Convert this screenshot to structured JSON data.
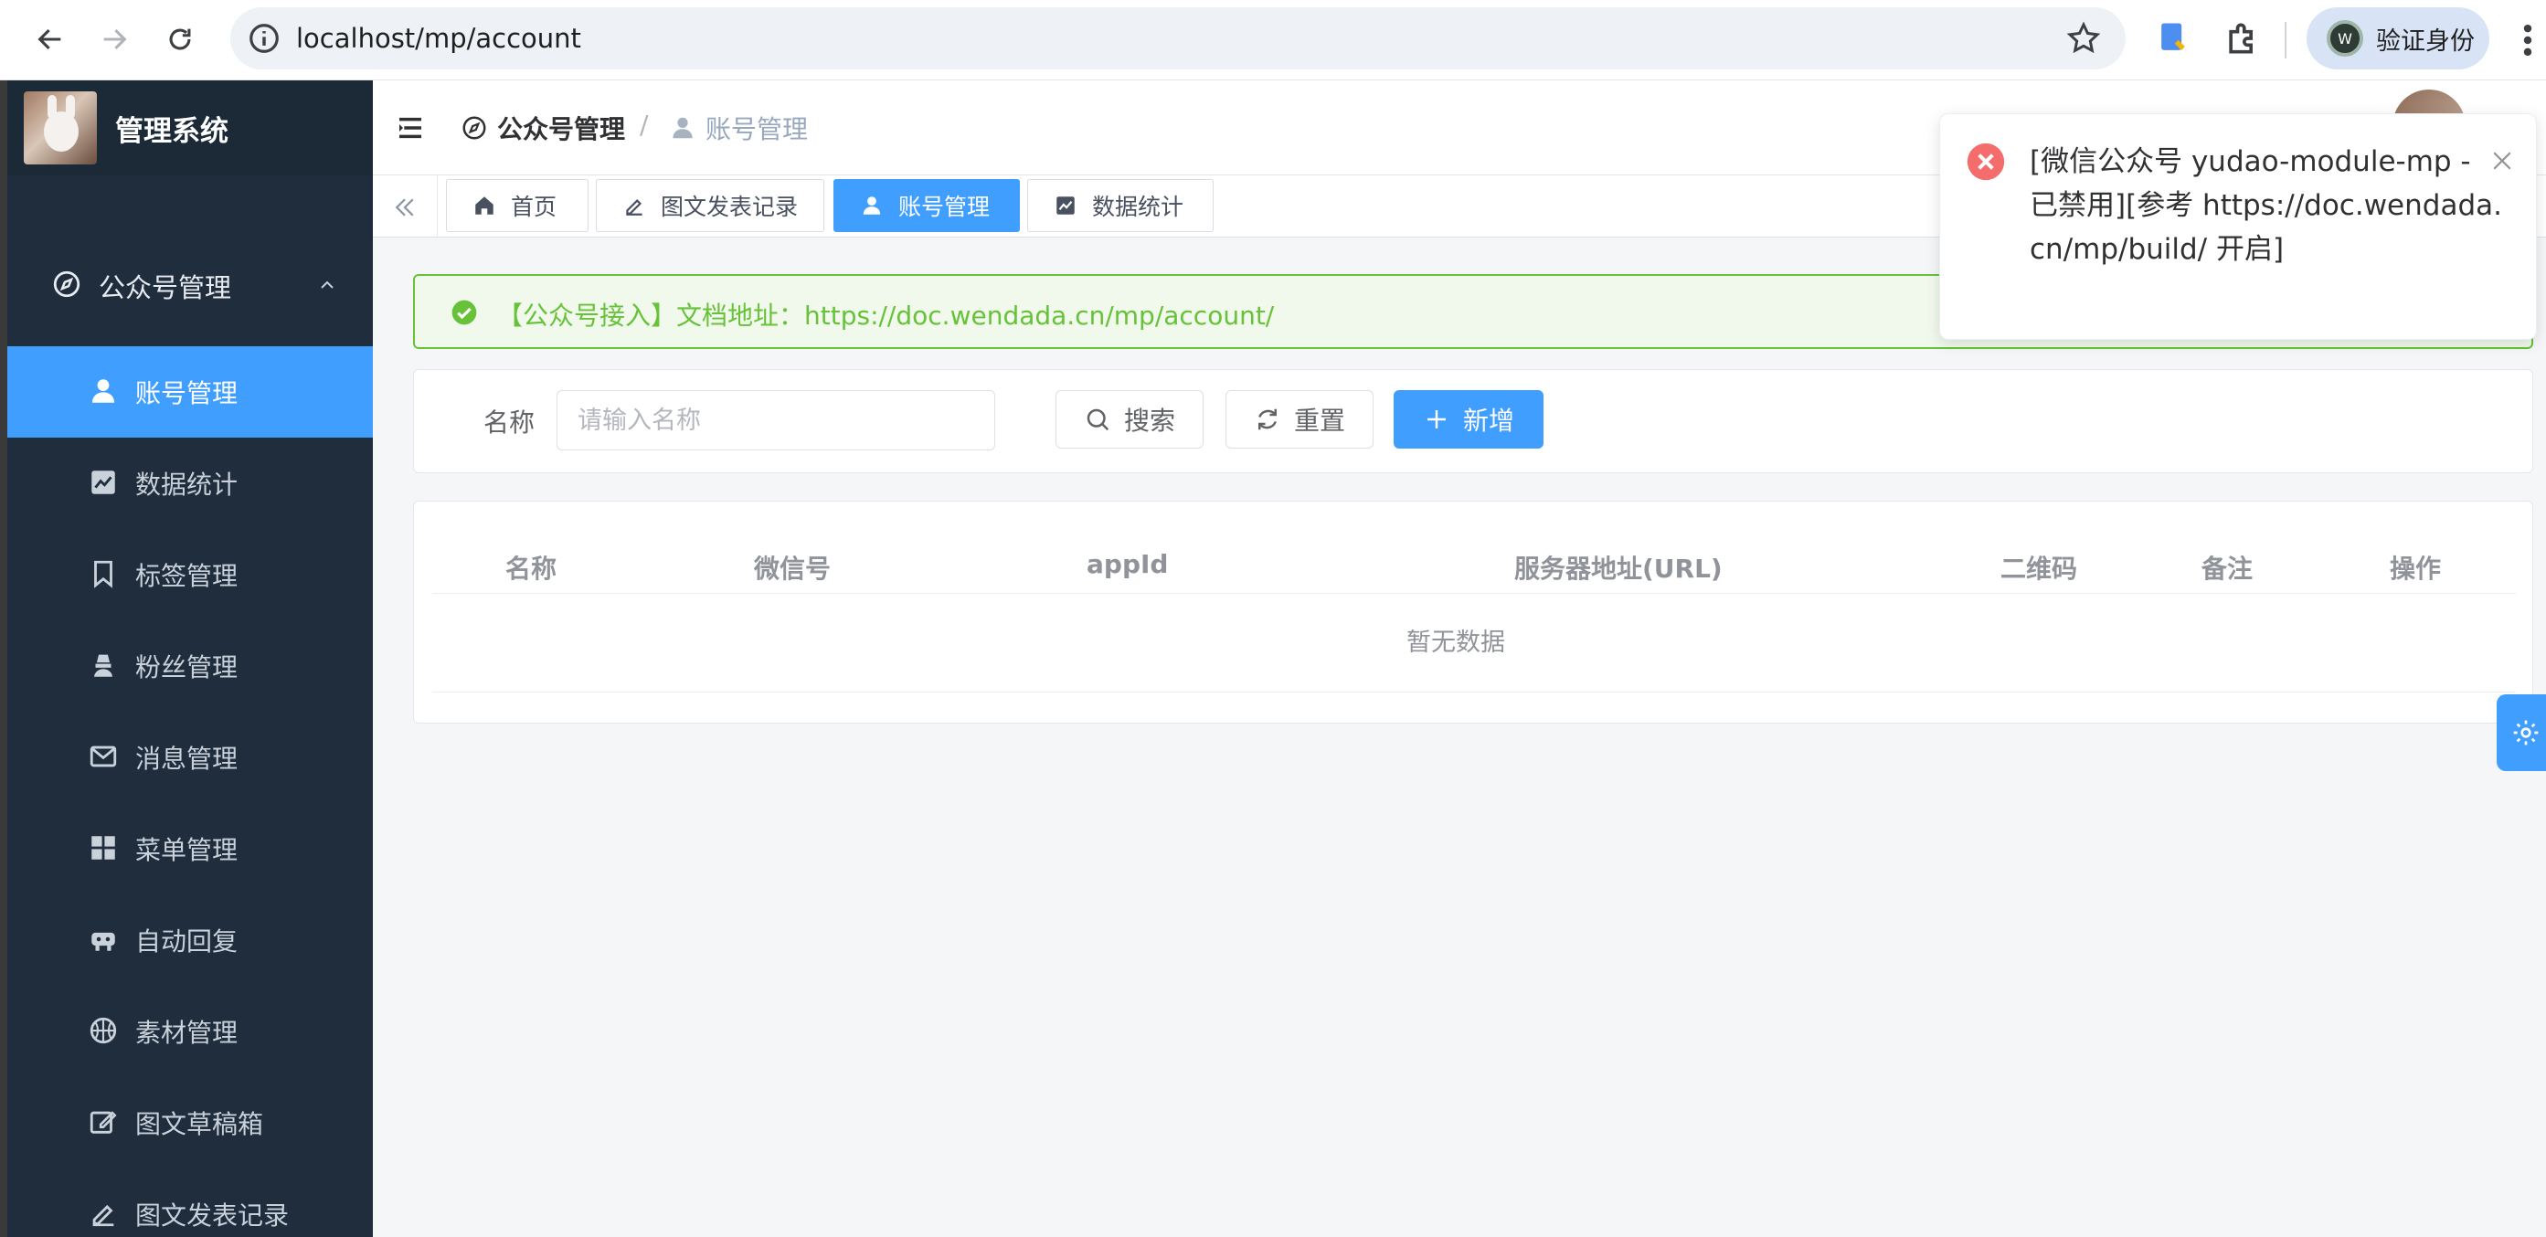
{
  "browser": {
    "url": "localhost/mp/account",
    "profile_label": "验证身份",
    "profile_initial": "W"
  },
  "sidebar": {
    "title": "管理系统",
    "parent_label": "公众号管理",
    "items": [
      {
        "label": "账号管理",
        "icon": "user-icon",
        "active": true
      },
      {
        "label": "数据统计",
        "icon": "chart-icon"
      },
      {
        "label": "标签管理",
        "icon": "bookmark-icon"
      },
      {
        "label": "粉丝管理",
        "icon": "fans-icon"
      },
      {
        "label": "消息管理",
        "icon": "mail-icon"
      },
      {
        "label": "菜单管理",
        "icon": "grid-icon"
      },
      {
        "label": "自动回复",
        "icon": "robot-icon"
      },
      {
        "label": "素材管理",
        "icon": "basketball-icon"
      },
      {
        "label": "图文草稿箱",
        "icon": "edit-box-icon"
      },
      {
        "label": "图文发表记录",
        "icon": "pen-icon"
      }
    ]
  },
  "header": {
    "breadcrumb_root": "公众号管理",
    "breadcrumb_sep": "/",
    "breadcrumb_current": "账号管理"
  },
  "tags": [
    {
      "label": "首页",
      "icon": "home-icon"
    },
    {
      "label": "图文发表记录",
      "icon": "pen-icon"
    },
    {
      "label": "账号管理",
      "icon": "user-icon",
      "active": true
    },
    {
      "label": "数据统计",
      "icon": "chart-icon"
    }
  ],
  "alert": {
    "text": "【公众号接入】文档地址：https://doc.wendada.cn/mp/account/"
  },
  "search": {
    "name_label": "名称",
    "name_placeholder": "请输入名称",
    "name_value": "",
    "search_label": "搜索",
    "reset_label": "重置",
    "add_label": "新增"
  },
  "table": {
    "columns": [
      "名称",
      "微信号",
      "appId",
      "服务器地址(URL)",
      "二维码",
      "备注",
      "操作"
    ],
    "rows": [],
    "empty_text": "暂无数据"
  },
  "notification": {
    "type": "error",
    "text": "[微信公众号 yudao-module-mp - 已禁用][参考 https://doc.wendada.cn/mp/build/ 开启]"
  },
  "colors": {
    "primary": "#409eff",
    "sidebar_bg": "#1f2d3d",
    "success": "#67c23a",
    "error": "#f56c6c"
  }
}
